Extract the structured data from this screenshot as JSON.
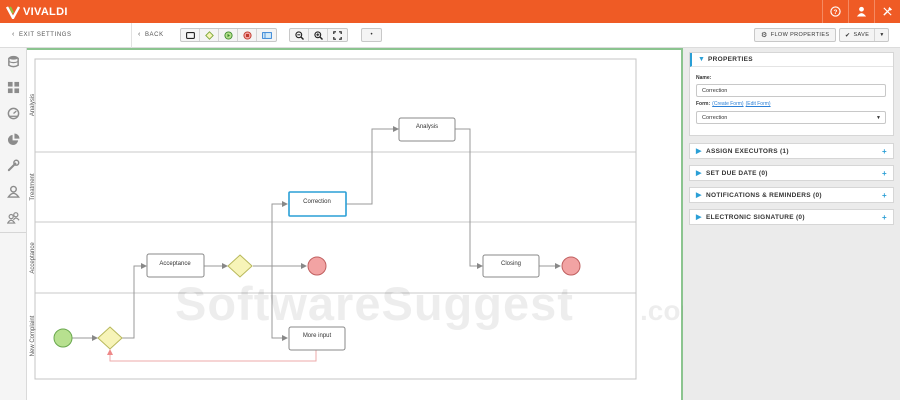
{
  "app": {
    "name": "VIVALDI"
  },
  "toolbar": {
    "exit_label": "EXIT SETTINGS",
    "back_label": "BACK",
    "flow_properties_label": "FLOW PROPERTIES",
    "save_label": "SAVE"
  },
  "sidebar": {
    "items": [
      {
        "icon": "database-icon"
      },
      {
        "icon": "dashboard-grid-icon"
      },
      {
        "icon": "gauge-icon"
      },
      {
        "icon": "pie-chart-icon"
      },
      {
        "icon": "wrench-icon"
      },
      {
        "icon": "user-icon"
      },
      {
        "icon": "users-group-icon"
      }
    ]
  },
  "diagram": {
    "lanes": [
      "Analysis",
      "Treatment",
      "Acceptance",
      "New Complaint"
    ],
    "tasks": {
      "analysis": "Analysis",
      "correction": "Correction",
      "acceptance": "Acceptance",
      "closing": "Closing",
      "more_input": "More input"
    }
  },
  "properties": {
    "title": "PROPERTIES",
    "name_label": "Name:",
    "name_value": "Correction",
    "form_label": "Form:",
    "create_form": "(Create Form)",
    "edit_form": "(Edit Form)",
    "form_value": "Correction"
  },
  "sections": [
    {
      "label": "ASSIGN EXECUTORS (1)"
    },
    {
      "label": "SET DUE DATE (0)"
    },
    {
      "label": "NOTIFICATIONS & REMINDERS (0)"
    },
    {
      "label": "ELECTRONIC SIGNATURE (0)"
    }
  ],
  "watermark": {
    "text": "SoftwareSuggest",
    "suffix": ".com"
  },
  "colors": {
    "brand": "#ef5b25",
    "accent": "#2a9fd6",
    "selected_task": "#2a9fd6",
    "start_event": "#b7e08f",
    "end_event": "#f2a3a3",
    "gateway": "#f7f4b8"
  }
}
